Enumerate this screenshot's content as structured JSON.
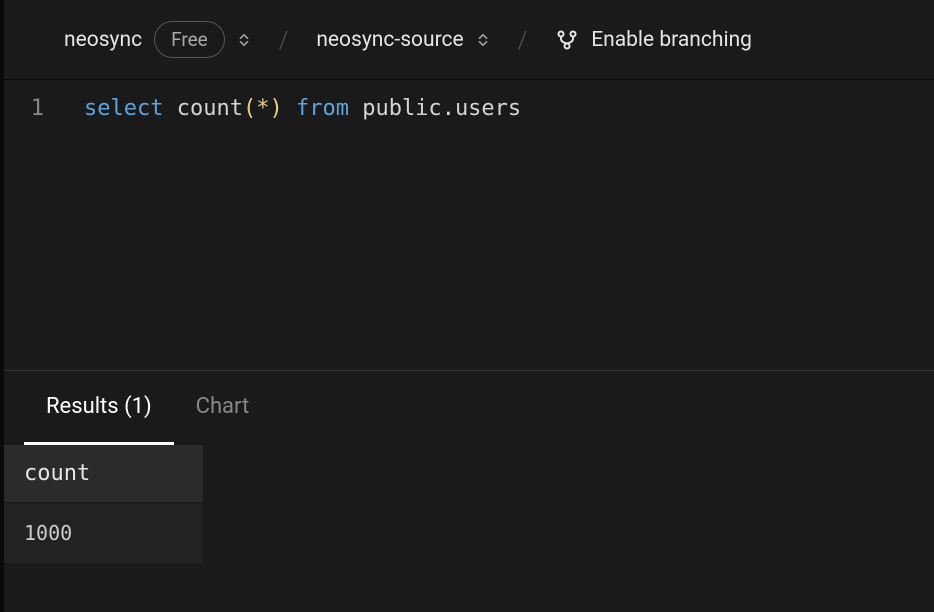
{
  "header": {
    "project_name": "neosync",
    "plan_badge": "Free",
    "database_name": "neosync-source",
    "branching_label": "Enable branching"
  },
  "editor": {
    "lines": [
      {
        "number": "1",
        "tokens": {
          "select": "select",
          "count_fn": "count",
          "lparen": "(",
          "star": "*",
          "rparen": ")",
          "from": "from",
          "schema": "public",
          "dot": ".",
          "table": "users"
        }
      }
    ]
  },
  "results": {
    "tabs": {
      "results_label": "Results (1)",
      "chart_label": "Chart"
    },
    "columns": [
      "count"
    ],
    "rows": [
      [
        "1000"
      ]
    ]
  }
}
